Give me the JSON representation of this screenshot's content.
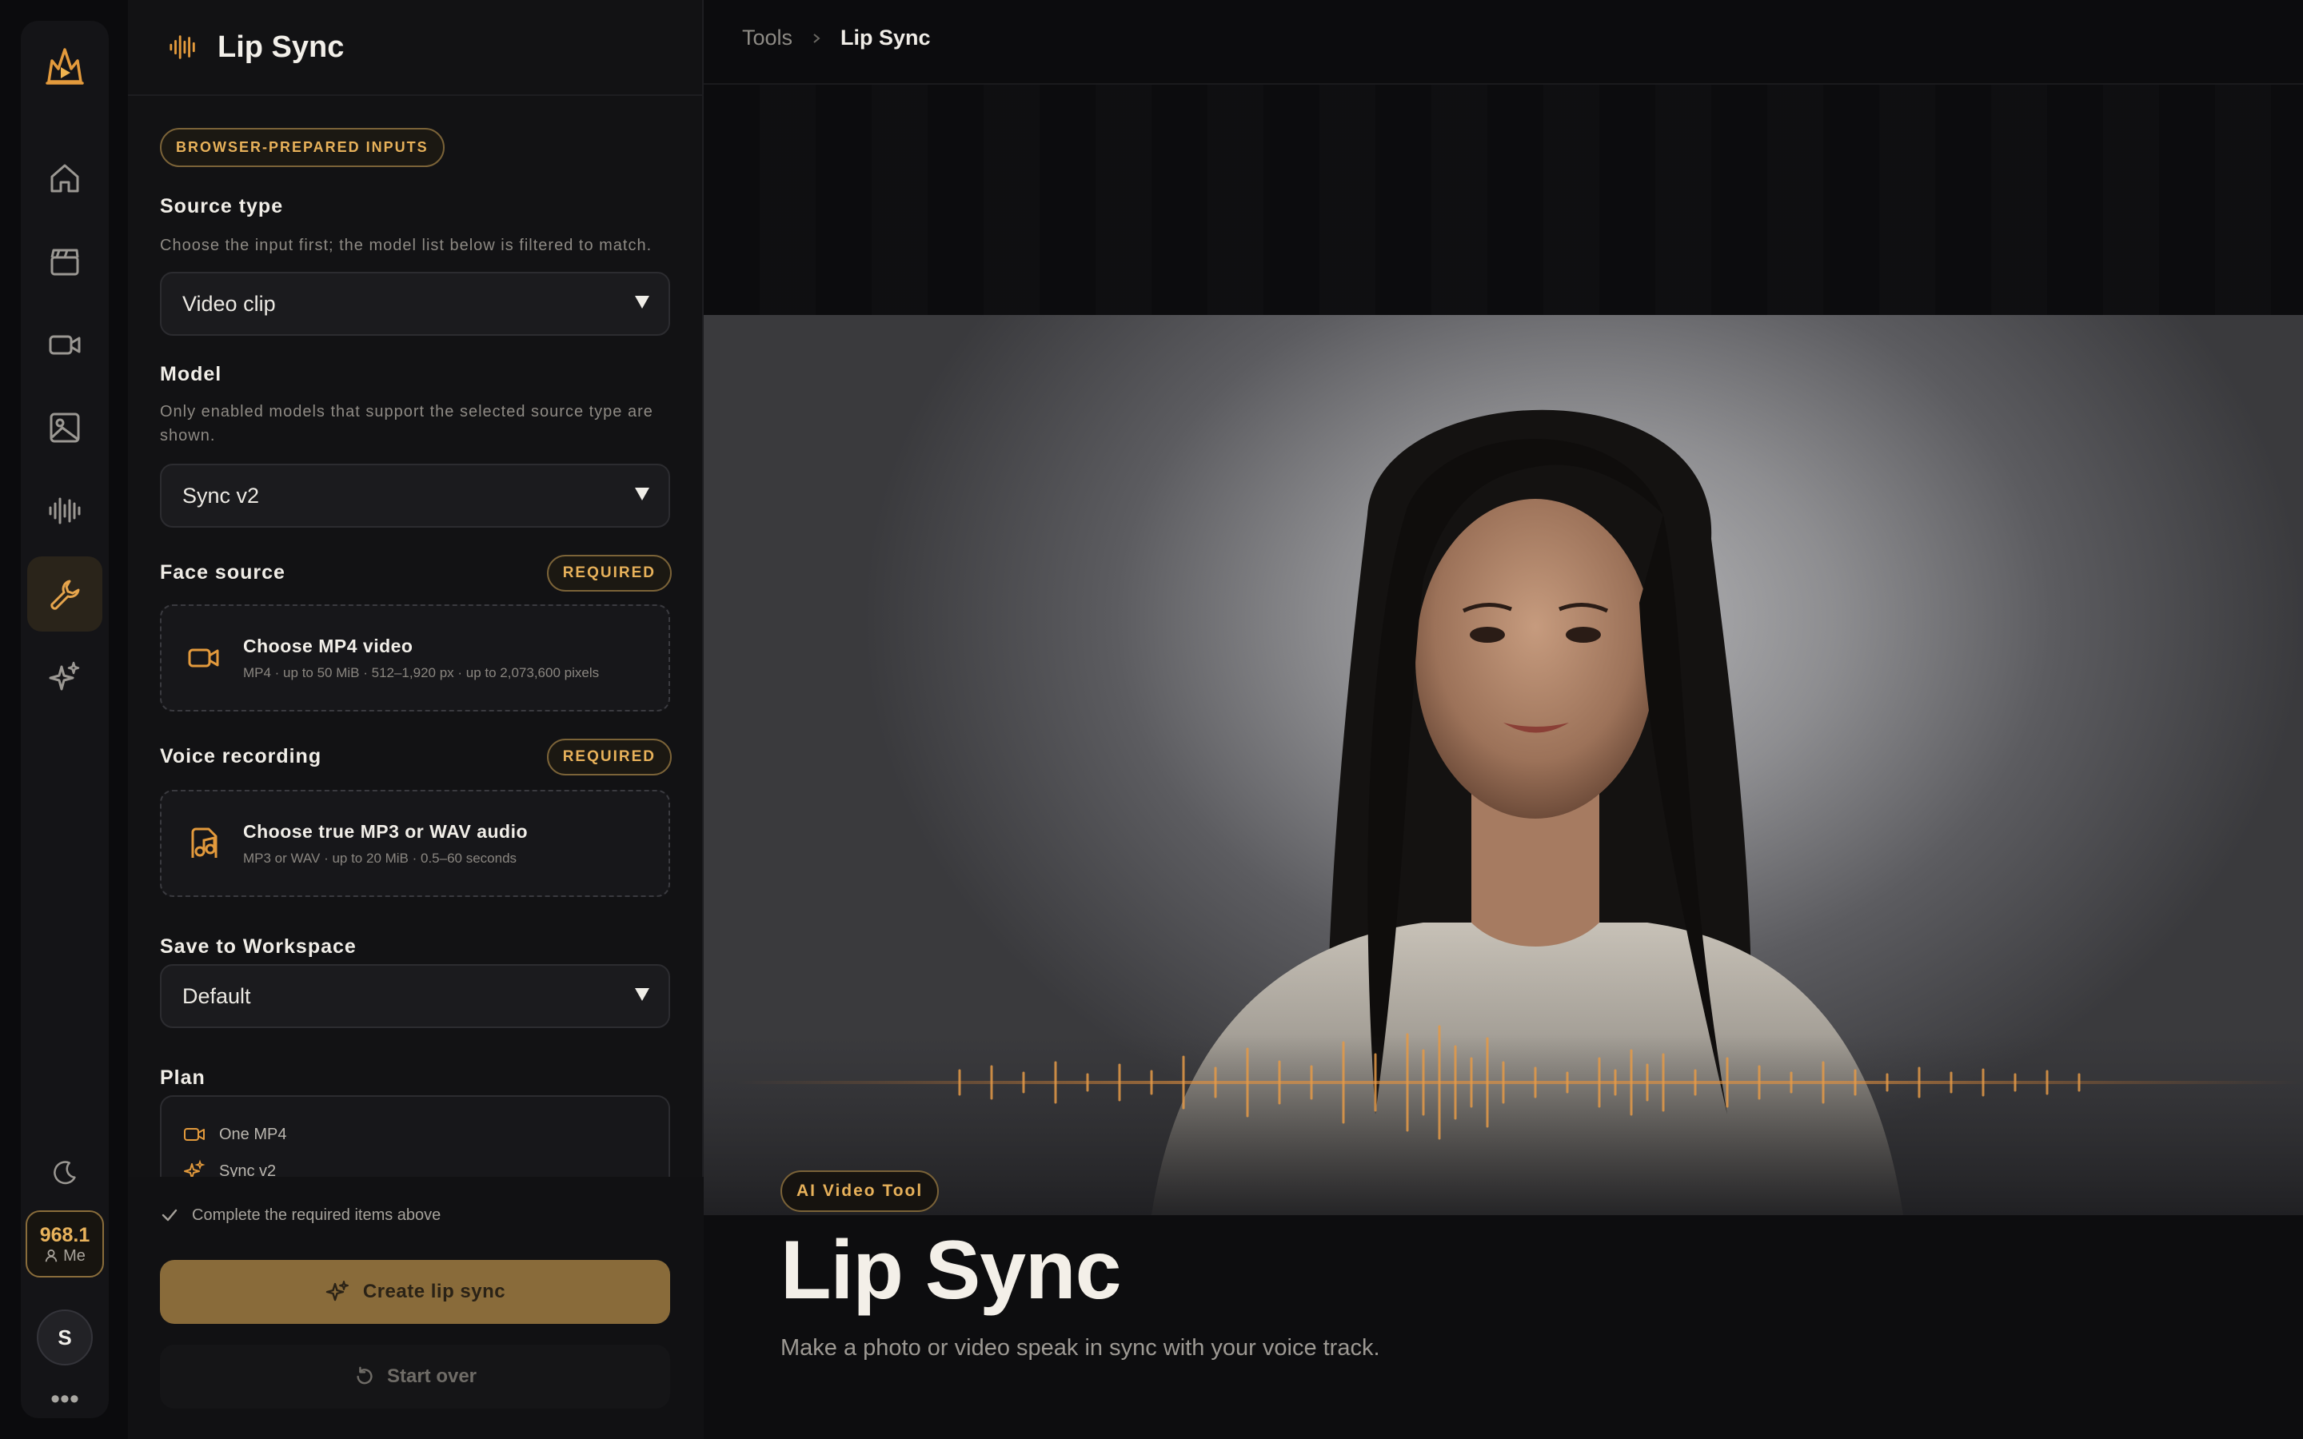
{
  "colors": {
    "accent": "#e7b15a",
    "accent_button": "#896b3a",
    "background": "#0b0b0d",
    "panel": "#121214"
  },
  "rail": {
    "icons": [
      "logo-icon",
      "home-icon",
      "clapperboard-icon",
      "video-camera-icon",
      "image-icon",
      "audio-wave-icon",
      "wrench-icon",
      "sparkles-icon",
      "moon-icon"
    ],
    "active_item": "wrench-icon",
    "credits": "968.1",
    "user_label": "Me",
    "avatar_initial": "S",
    "more": "•••"
  },
  "panel": {
    "title": "Lip Sync",
    "badge": "BROWSER-PREPARED INPUTS",
    "source_type": {
      "label": "Source type",
      "help": "Choose the input first; the model list below is filtered to match.",
      "value": "Video clip"
    },
    "model": {
      "label": "Model",
      "help": "Only enabled models that support the selected source type are shown.",
      "value": "Sync v2"
    },
    "face_source": {
      "label": "Face source",
      "required": "REQUIRED",
      "title": "Choose MP4 video",
      "details": "MP4 · up to 50 MiB · 512–1,920 px · up to 2,073,600 pixels"
    },
    "voice_recording": {
      "label": "Voice recording",
      "required": "REQUIRED",
      "title": "Choose true MP3 or WAV audio",
      "details": "MP3 or WAV · up to 20 MiB · 0.5–60 seconds"
    },
    "workspace": {
      "label": "Save to Workspace",
      "value": "Default"
    },
    "plan": {
      "label": "Plan",
      "items": [
        "One MP4",
        "Sync v2"
      ]
    },
    "status_text": "Complete the required items above",
    "create_label": "Create lip sync",
    "start_over_label": "Start over"
  },
  "main": {
    "breadcrumb": [
      "Tools",
      "Lip Sync"
    ],
    "tag": "AI Video Tool",
    "title": "Lip Sync",
    "subtitle": "Make a photo or video speak in sync with your voice track."
  }
}
